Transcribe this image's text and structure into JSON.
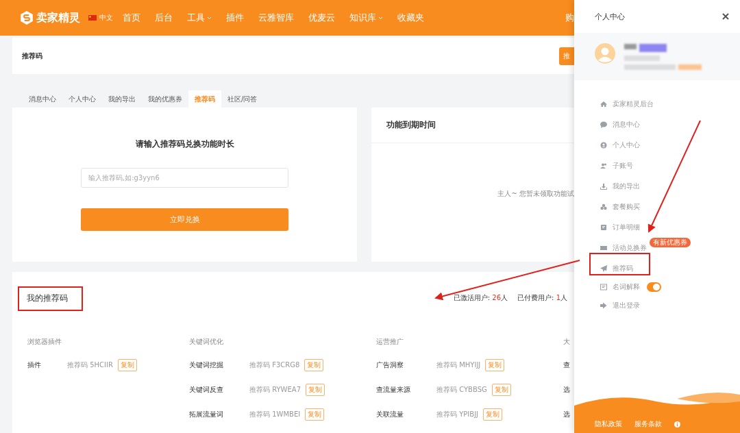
{
  "nav": {
    "logo": "卖家精灵",
    "language": "中文",
    "items": [
      {
        "label": "首页",
        "dropdown": false
      },
      {
        "label": "后台",
        "dropdown": false
      },
      {
        "label": "工具",
        "dropdown": true
      },
      {
        "label": "插件",
        "dropdown": false
      },
      {
        "label": "云雅智库",
        "dropdown": false
      },
      {
        "label": "优麦云",
        "dropdown": false
      },
      {
        "label": "知识库",
        "dropdown": true
      },
      {
        "label": "收藏夹",
        "dropdown": false
      }
    ],
    "cut_item": "购"
  },
  "breadcrumb": {
    "title": "推荐码",
    "button": "推"
  },
  "tabs": [
    {
      "label": "消息中心",
      "selected": false
    },
    {
      "label": "个人中心",
      "selected": false
    },
    {
      "label": "我的导出",
      "selected": false
    },
    {
      "label": "我的优惠券",
      "selected": false
    },
    {
      "label": "推荐码",
      "selected": true
    },
    {
      "label": "社区/问答",
      "selected": false
    }
  ],
  "redeem_card": {
    "title": "请输入推荐码兑换功能时长",
    "input": {
      "placeholder": "输入推荐码,如:g3yyn6"
    },
    "button": "立即兑换"
  },
  "expiry_card": {
    "title": "功能到期时间",
    "message": "主人~ 您暂未领取功能试"
  },
  "referral": {
    "title": "我的推荐码",
    "stats": [
      {
        "label": "已激活用户:",
        "value": "26",
        "unit": "人"
      },
      {
        "label": "已付费用户:",
        "value": "1",
        "unit": "人"
      }
    ],
    "columns": [
      {
        "heading": "浏览器插件",
        "rows": [
          {
            "name": "插件",
            "code_label": "推荐码",
            "code": "5HCIIR",
            "copy": "复制"
          }
        ]
      },
      {
        "heading": "关键词优化",
        "rows": [
          {
            "name": "关键词挖掘",
            "code_label": "推荐码",
            "code": "F3CRG8",
            "copy": "复制"
          },
          {
            "name": "关键词反查",
            "code_label": "推荐码",
            "code": "RYWEA7",
            "copy": "复制"
          },
          {
            "name": "拓展流量词",
            "code_label": "推荐码",
            "code": "1WMBEI",
            "copy": "复制"
          }
        ]
      },
      {
        "heading": "运营推广",
        "rows": [
          {
            "name": "广告洞察",
            "code_label": "推荐码",
            "code": "MHYIJJ",
            "copy": "复制"
          },
          {
            "name": "查流量来源",
            "code_label": "推荐码",
            "code": "CYBBSG",
            "copy": "复制"
          },
          {
            "name": "关联流量",
            "code_label": "推荐码",
            "code": "YPIBJJ",
            "copy": "复制"
          }
        ]
      },
      {
        "heading": "大",
        "rows": [
          {
            "name": "查"
          },
          {
            "name": "选"
          },
          {
            "name": "选"
          }
        ]
      }
    ]
  },
  "drawer": {
    "title": "个人中心",
    "menu": [
      {
        "kind": "link",
        "label": "卖家精灵后台"
      },
      {
        "kind": "link",
        "label": "消息中心"
      },
      {
        "kind": "link",
        "label": "个人中心"
      },
      {
        "kind": "link",
        "label": "子账号"
      },
      {
        "kind": "link",
        "label": "我的导出"
      },
      {
        "kind": "link",
        "label": "套餐购买"
      },
      {
        "kind": "link",
        "label": "订单明细"
      },
      {
        "kind": "link",
        "label": "活动兑换券",
        "badge": "有新优惠券"
      },
      {
        "kind": "link",
        "label": "推荐码"
      },
      {
        "kind": "toggle",
        "label": "名词解释",
        "on": true
      },
      {
        "kind": "link",
        "label": "退出登录"
      }
    ],
    "footer": [
      "隐私政策",
      "服务条款"
    ]
  }
}
